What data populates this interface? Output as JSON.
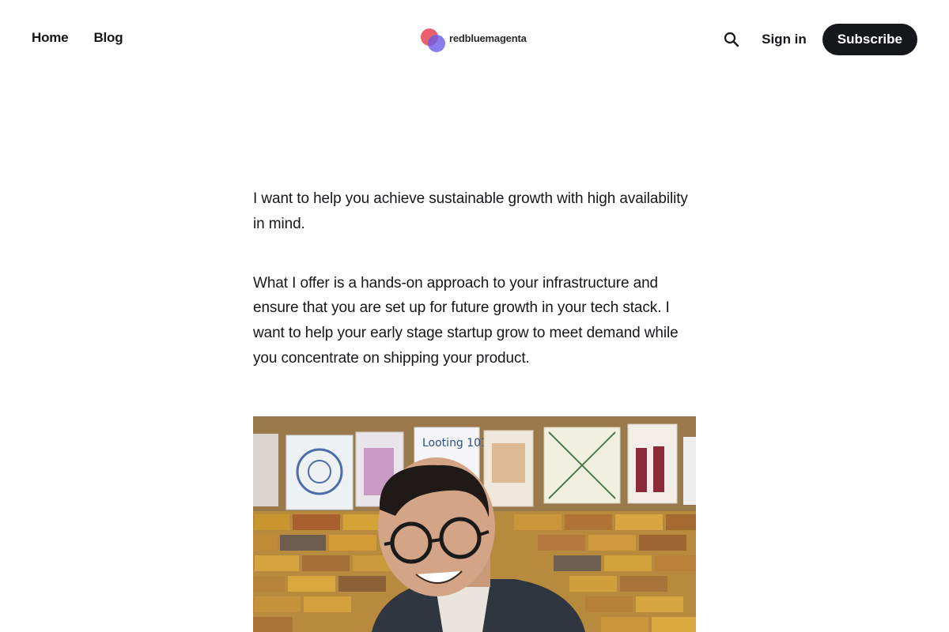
{
  "nav": {
    "home": "Home",
    "blog": "Blog"
  },
  "brand": {
    "name": "redbluemagenta",
    "colors": {
      "red": "#e8505b",
      "blue": "#6b5ce7"
    }
  },
  "actions": {
    "search_icon": "search-icon",
    "signin": "Sign in",
    "subscribe": "Subscribe"
  },
  "article": {
    "paragraphs": [
      "I want to help you achieve sustainable growth with high availability in mind.",
      "What I offer is a hands-on approach to your infrastructure and ensure that you are set up for future growth in your tech stack. I want to help your early stage startup grow to meet demand while you concentrate on shipping your product."
    ]
  },
  "colors": {
    "text": "#15171a",
    "background": "#ffffff",
    "button": "#15171a"
  }
}
